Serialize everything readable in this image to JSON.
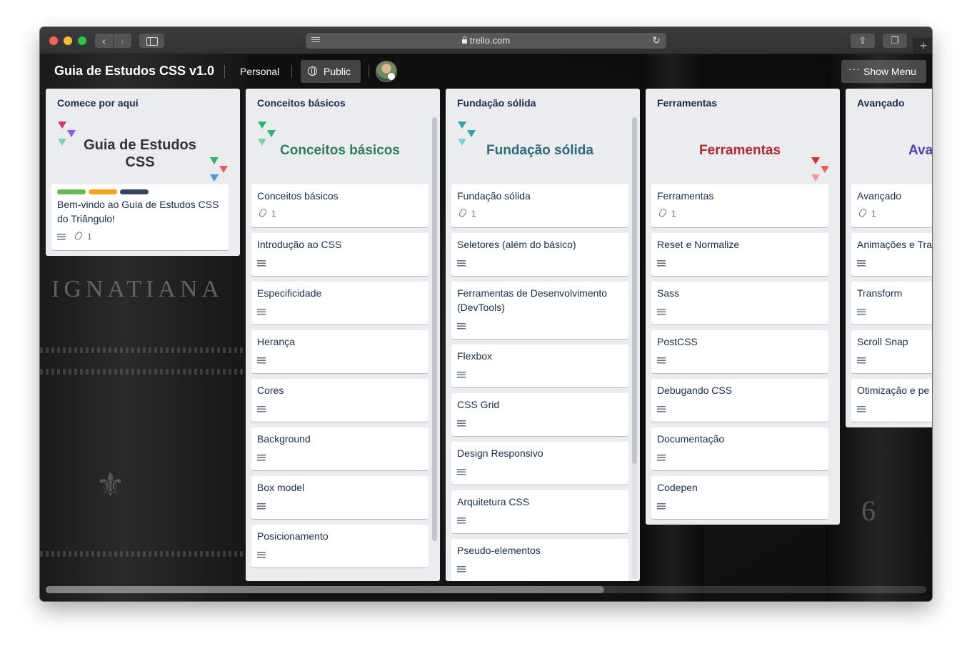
{
  "browser": {
    "url": "trello.com"
  },
  "header": {
    "board_title": "Guia de Estudos CSS v1.0",
    "team": "Personal",
    "visibility": "Public",
    "menu_label": "Show Menu",
    "menu_icon": "ellipsis-icon"
  },
  "background": {
    "book_text": "IGNATIANA",
    "spine_number": "6"
  },
  "lists": [
    {
      "title": "Comece por aqui",
      "cover_title_line1": "Guia de Estudos",
      "cover_title_line2": "CSS",
      "labels": [
        "#61bd4f",
        "#ff9f1a",
        "#344563"
      ],
      "cards": [
        {
          "title": "Bem-vindo ao Guia de Estudos CSS do Triângulo!",
          "attachments": "1"
        }
      ]
    },
    {
      "title": "Conceitos básicos",
      "cover_title": "Conceitos básicos",
      "cover_color": "#2f7d5b",
      "cards": [
        {
          "title": "Conceitos básicos",
          "attachments": "1"
        },
        {
          "title": "Introdução ao CSS"
        },
        {
          "title": "Especificidade"
        },
        {
          "title": "Herança"
        },
        {
          "title": "Cores"
        },
        {
          "title": "Background"
        },
        {
          "title": "Box model"
        },
        {
          "title": "Posicionamento"
        }
      ]
    },
    {
      "title": "Fundação sólida",
      "cover_title": "Fundação sólida",
      "cover_color": "#2b6a77",
      "cards": [
        {
          "title": "Fundação sólida",
          "attachments": "1"
        },
        {
          "title": "Seletores (além do básico)"
        },
        {
          "title": "Ferramentas de Desenvolvimento (DevTools)"
        },
        {
          "title": "Flexbox"
        },
        {
          "title": "CSS Grid"
        },
        {
          "title": "Design Responsivo"
        },
        {
          "title": "Arquitetura CSS"
        },
        {
          "title": "Pseudo-elementos"
        }
      ]
    },
    {
      "title": "Ferramentas",
      "cover_title": "Ferramentas",
      "cover_color": "#b0282f",
      "cards": [
        {
          "title": "Ferramentas",
          "attachments": "1"
        },
        {
          "title": "Reset e Normalize"
        },
        {
          "title": "Sass"
        },
        {
          "title": "PostCSS"
        },
        {
          "title": "Debugando CSS"
        },
        {
          "title": "Documentação"
        },
        {
          "title": "Codepen"
        }
      ]
    },
    {
      "title": "Avançado",
      "cover_title": "Ava",
      "cover_color": "#5a3fa8",
      "cards": [
        {
          "title": "Avançado",
          "attachments": "1"
        },
        {
          "title": "Animações e Tra"
        },
        {
          "title": "Transform"
        },
        {
          "title": "Scroll Snap"
        },
        {
          "title": "Otimização e pe"
        }
      ]
    }
  ]
}
